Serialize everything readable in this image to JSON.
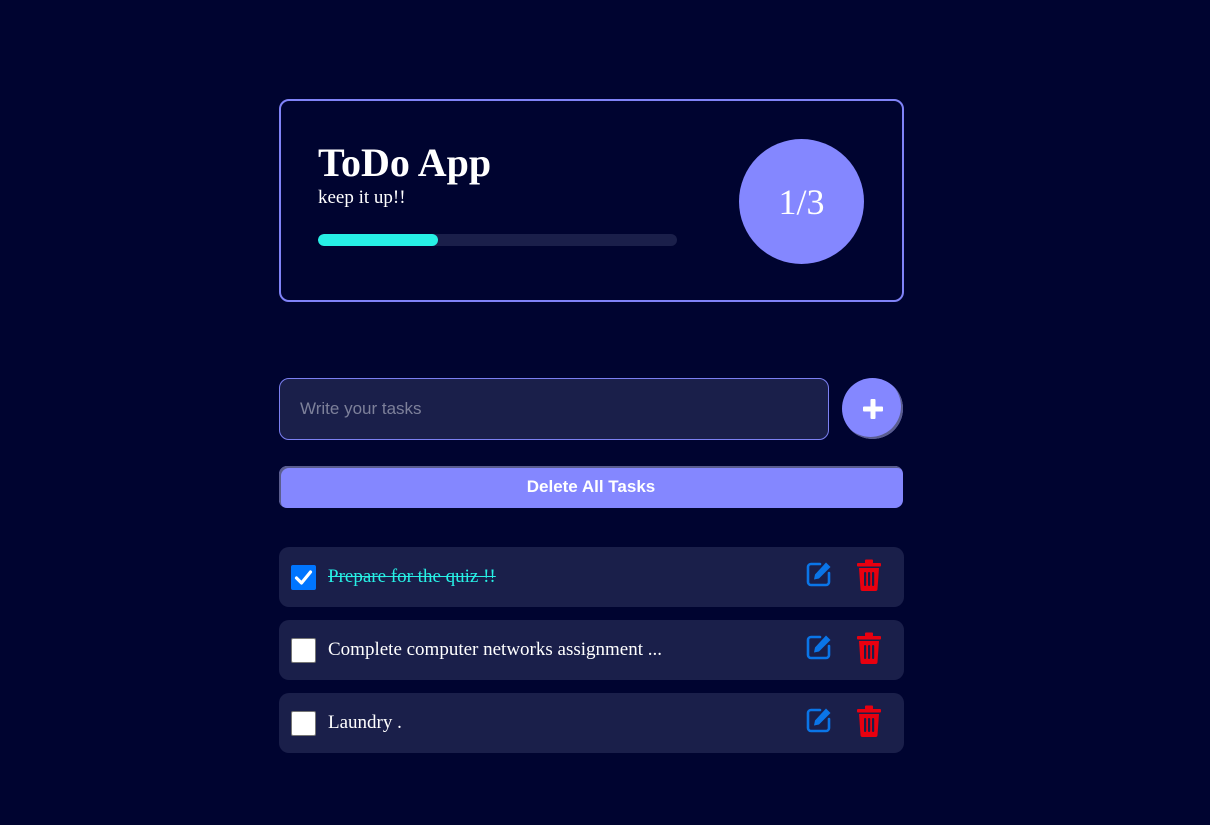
{
  "header": {
    "title": "ToDo App",
    "subtitle": "keep it up!!",
    "progress_fraction": 0.333,
    "counter": "1/3"
  },
  "input": {
    "placeholder": "Write your tasks",
    "value": "",
    "add_icon": "plus-icon"
  },
  "delete_all_label": "Delete All Tasks",
  "tasks": [
    {
      "text": "Prepare for the quiz !!",
      "completed": true
    },
    {
      "text": "Complete computer networks assignment ...",
      "completed": false
    },
    {
      "text": "Laundry .",
      "completed": false
    }
  ],
  "icons": {
    "edit": "edit-icon",
    "delete": "trash-icon",
    "check": "checkmark-icon"
  },
  "colors": {
    "background": "#000430",
    "accent": "#8487ff",
    "progress": "#27f0e5",
    "edit_icon": "#0a75e8",
    "delete_icon": "#e8000f",
    "row_bg": "#1a1f4a"
  }
}
